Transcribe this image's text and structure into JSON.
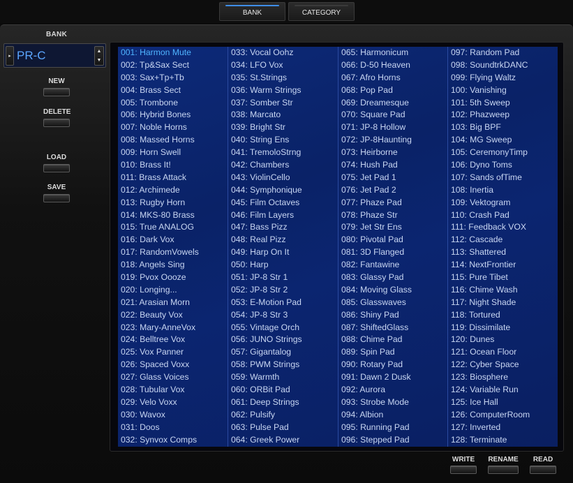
{
  "tabs": [
    {
      "label": "BANK",
      "active": true
    },
    {
      "label": "CATEGORY",
      "active": false
    }
  ],
  "sidebar": {
    "bank_label": "BANK",
    "bank_value": "PR-C",
    "buttons": {
      "new": "NEW",
      "delete": "DELETE",
      "load": "LOAD",
      "save": "SAVE"
    }
  },
  "footer": {
    "write": "WRITE",
    "rename": "RENAME",
    "read": "READ"
  },
  "colors": {
    "accent": "#3f8ee8",
    "list_background": "#0b2570",
    "selected_text": "#4fb4ff"
  },
  "selected_index": 0,
  "patches": [
    [
      "001: Harmon Mute",
      "002: Tp&Sax Sect",
      "003: Sax+Tp+Tb",
      "004: Brass Sect",
      "005: Trombone",
      "006: Hybrid Bones",
      "007: Noble Horns",
      "008: Massed Horns",
      "009: Horn Swell",
      "010: Brass It!",
      "011: Brass Attack",
      "012: Archimede",
      "013: Rugby Horn",
      "014: MKS-80 Brass",
      "015: True ANALOG",
      "016: Dark Vox",
      "017: RandomVowels",
      "018: Angels Sing",
      "019: Pvox Oooze",
      "020: Longing...",
      "021: Arasian Morn",
      "022: Beauty Vox",
      "023: Mary-AnneVox",
      "024: Belltree Vox",
      "025: Vox Panner",
      "026: Spaced Voxx",
      "027: Glass Voices",
      "028: Tubular Vox",
      "029: Velo Voxx",
      "030: Wavox",
      "031: Doos",
      "032: Synvox Comps"
    ],
    [
      "033: Vocal Oohz",
      "034: LFO Vox",
      "035: St.Strings",
      "036: Warm Strings",
      "037: Somber Str",
      "038: Marcato",
      "039: Bright Str",
      "040: String Ens",
      "041: TremoloStrng",
      "042: Chambers",
      "043: ViolinCello",
      "044: Symphonique",
      "045: Film Octaves",
      "046: Film Layers",
      "047: Bass Pizz",
      "048: Real Pizz",
      "049: Harp On It",
      "050: Harp",
      "051: JP-8 Str 1",
      "052: JP-8 Str 2",
      "053: E-Motion Pad",
      "054: JP-8 Str 3",
      "055: Vintage Orch",
      "056: JUNO Strings",
      "057: Gigantalog",
      "058: PWM Strings",
      "059: Warmth",
      "060: ORBit Pad",
      "061: Deep Strings",
      "062: Pulsify",
      "063: Pulse Pad",
      "064: Greek Power"
    ],
    [
      "065: Harmonicum",
      "066: D-50 Heaven",
      "067: Afro Horns",
      "068: Pop Pad",
      "069: Dreamesque",
      "070: Square Pad",
      "071: JP-8 Hollow",
      "072: JP-8Haunting",
      "073: Heirborne",
      "074: Hush Pad",
      "075: Jet Pad 1",
      "076: Jet Pad 2",
      "077: Phaze Pad",
      "078: Phaze Str",
      "079: Jet Str Ens",
      "080: Pivotal Pad",
      "081: 3D Flanged",
      "082: Fantawine",
      "083: Glassy Pad",
      "084: Moving Glass",
      "085: Glasswaves",
      "086: Shiny Pad",
      "087: ShiftedGlass",
      "088: Chime Pad",
      "089: Spin Pad",
      "090: Rotary Pad",
      "091: Dawn 2 Dusk",
      "092: Aurora",
      "093: Strobe Mode",
      "094: Albion",
      "095: Running Pad",
      "096: Stepped Pad"
    ],
    [
      "097: Random Pad",
      "098: SoundtrkDANC",
      "099: Flying Waltz",
      "100: Vanishing",
      "101: 5th Sweep",
      "102: Phazweep",
      "103: Big BPF",
      "104: MG Sweep",
      "105: CeremonyTimp",
      "106: Dyno Toms",
      "107: Sands ofTime",
      "108: Inertia",
      "109: Vektogram",
      "110: Crash Pad",
      "111: Feedback VOX",
      "112: Cascade",
      "113: Shattered",
      "114: NextFrontier",
      "115: Pure Tibet",
      "116: Chime Wash",
      "117: Night Shade",
      "118: Tortured",
      "119: Dissimilate",
      "120: Dunes",
      "121: Ocean Floor",
      "122: Cyber Space",
      "123: Biosphere",
      "124: Variable Run",
      "125: Ice Hall",
      "126: ComputerRoom",
      "127: Inverted",
      "128: Terminate"
    ]
  ]
}
